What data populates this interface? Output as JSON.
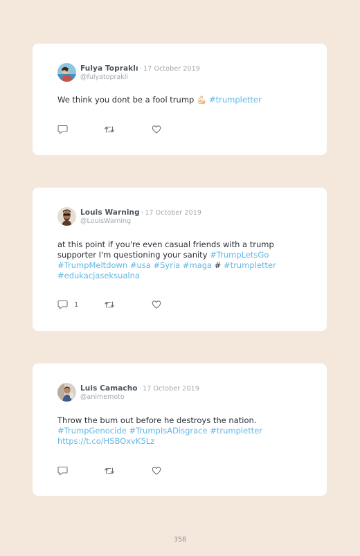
{
  "tweets": [
    {
      "name": "Fulya Topraklı",
      "date": "17 October 2019",
      "handle": "@fulyatoprakli",
      "text": "We think you dont be a fool trump 💪🏻",
      "hashtags": "#trumpletter",
      "reply_count": "",
      "avatar_colors": [
        "#79b9d8",
        "#c4544a"
      ]
    },
    {
      "name": "Louis Warning",
      "date": "17 October 2019",
      "handle": "@LouisWarning",
      "line1": "at this point if you're even casual friends with a trump",
      "line2_text": "supporter I'm questioning your sanity ",
      "line2_tag": "#TrumpLetsGo",
      "line3_tags_a": "#TrumpMeltdown #usa #Syria #maga",
      "line3_plain": " # ",
      "line3_tags_b": "#trumpletter",
      "line4_tag": "#edukacjaseksualna",
      "reply_count": "1",
      "avatar_colors": [
        "#d9cfc4",
        "#5a3a2a"
      ]
    },
    {
      "name": "Luis Camacho",
      "date": "17 October 2019",
      "handle": "@animemoto",
      "line1": "Throw the bum out before he destroys the nation.",
      "line2_tags": "#TrumpGenocide #TrumpIsADisgrace #trumpletter",
      "line3_link": "https://t.co/HSBOxvK5Lz",
      "reply_count": "",
      "avatar_colors": [
        "#c9c4bc",
        "#3c5a8a"
      ]
    }
  ],
  "colors": {
    "background": "#f4e8dc",
    "card": "#ffffff",
    "hashtag": "#5fb8e6",
    "icon": "#6b747c"
  },
  "icons": [
    "reply-icon",
    "retweet-icon",
    "like-icon"
  ],
  "page_number": "358"
}
